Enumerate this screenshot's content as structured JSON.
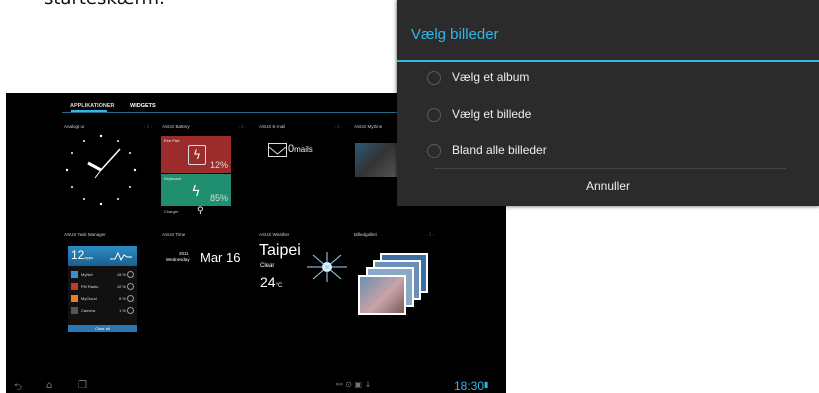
{
  "caption": "starteskærm.",
  "tablet": {
    "tabs": [
      "APPLIKATIONER",
      "WIDGETS"
    ],
    "widgets": {
      "analog": "Analogt ur",
      "battery": "ASUS Battery",
      "email": "ASUS E-mail",
      "myzine": "ASUS MyZine",
      "taskmanager": "ASUS Task Manager",
      "time": "ASUS Time",
      "weather": "ASUS Weather",
      "gallery": "Billedgalleri"
    },
    "battery": {
      "label1": "Eee Pad",
      "pct1": "12%",
      "label2": "Keyboard",
      "pct2": "85%",
      "charger": "Charger"
    },
    "email": {
      "count": "0",
      "unit": "mails"
    },
    "taskmanager": {
      "count": "12",
      "unit": "apps",
      "rows": [
        {
          "name": "MyNet",
          "pct": "15 %"
        },
        {
          "name": "FM Radio",
          "pct": "10 %"
        },
        {
          "name": "MyCloud",
          "pct": "6 %"
        },
        {
          "name": "Camera",
          "pct": "1 %"
        }
      ],
      "button": "Clear all"
    },
    "time": {
      "year": "2011",
      "day": "Wednesday",
      "date": "Mar 16"
    },
    "weather": {
      "city": "Taipei",
      "condition": "Clear",
      "temp": "24",
      "unit": "°C"
    },
    "status_time": "18:30"
  },
  "dialog": {
    "title": "Vælg billeder",
    "options": [
      "Vælg et album",
      "Vælg et billede",
      "Bland alle billeder"
    ],
    "cancel": "Annuller"
  },
  "colors": {
    "accent": "#33b5e5",
    "dialog_bg": "#2b2b2b",
    "tablet_bg": "#000000"
  }
}
